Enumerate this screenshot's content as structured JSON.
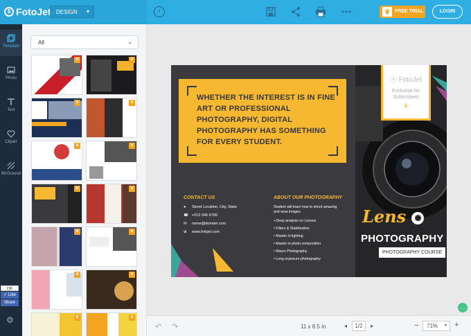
{
  "app": {
    "name": "FotoJet",
    "mode": "DESIGN"
  },
  "toolbar": {
    "free_trial": "FREE TRIAL",
    "login": "LOGIN"
  },
  "sidebar": {
    "items": [
      {
        "label": "Template",
        "icon": "template-icon"
      },
      {
        "label": "Photo",
        "icon": "photo-icon"
      },
      {
        "label": "Text",
        "icon": "text-icon"
      },
      {
        "label": "Clipart",
        "icon": "clipart-icon"
      },
      {
        "label": "BKGround",
        "icon": "background-icon"
      }
    ],
    "fb_count": "23K",
    "fb_like": "Like",
    "fb_share": "Share"
  },
  "panel": {
    "filter_value": "All"
  },
  "brochure": {
    "headline": "WHETHER THE INTEREST IS IN FINE ART OR PROFESSIONAL PHOTOGRAPHY, DIGITAL PHOTOGRAPHY HAS SOMETHING FOR EVERY STUDENT.",
    "contact_title": "CONTACT US",
    "contact": [
      {
        "icon": "location-icon",
        "text": "Street Location, City, State"
      },
      {
        "icon": "phone-icon",
        "text": "+012 345 6789"
      },
      {
        "icon": "email-icon",
        "text": "name@domain.com"
      },
      {
        "icon": "web-icon",
        "text": "www.fotojet.com"
      }
    ],
    "about_title": "ABOUT OUR PHOTOGRAPHY",
    "about_intro": "Student will learn how to shoot amazing and wow images.",
    "about_items": [
      "• Deep analysis on Lenses",
      "• Filters & Stabilization",
      "• Master in lighting",
      "• Master in photo composition",
      "• Macro Photography",
      "• Long exposure photography"
    ],
    "ribbon_logo": "FotoJet",
    "ribbon_text": "Exclusive for Subscribers",
    "lens": "Lens",
    "photography": "PHOTOGRAPHY",
    "course": "PHOTOGRAPHY COURSE"
  },
  "bottom": {
    "size": "11 x 8.5 in",
    "page": "1/2",
    "zoom": "71%"
  },
  "colors": {
    "accent": "#2faee3",
    "gold": "#f5b830",
    "dark": "#3b3a3f"
  }
}
